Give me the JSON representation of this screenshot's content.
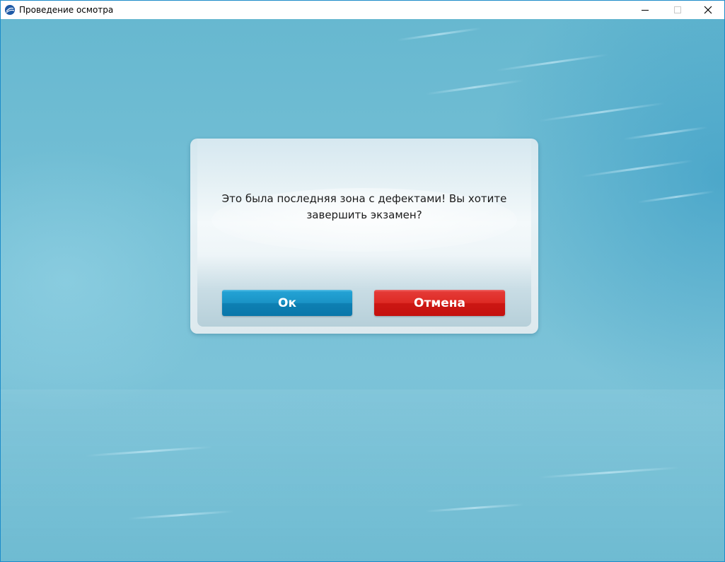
{
  "window": {
    "title": "Проведение осмотра",
    "icon": "app-logo-icon",
    "controls": {
      "minimize_icon": "minimize-icon",
      "maximize_icon": "maximize-icon",
      "close_icon": "close-icon"
    }
  },
  "dialog": {
    "message_line1": "Это была последняя зона с дефектами! Вы хотите",
    "message_line2": "завершить экзамен?",
    "ok_label": "Ок",
    "cancel_label": "Отмена"
  },
  "colors": {
    "background": "#74bfd5",
    "ok_button": "#1a93c6",
    "cancel_button": "#de2a24",
    "window_border": "#1d8cc9"
  }
}
